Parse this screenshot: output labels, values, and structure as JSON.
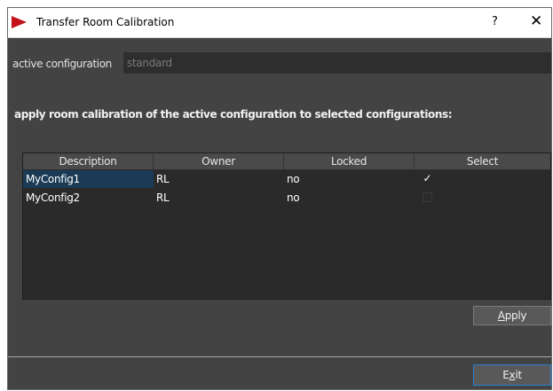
{
  "window": {
    "title": "Transfer Room Calibration",
    "help_label": "?",
    "close_label": "✕"
  },
  "active_configuration": {
    "label": "active configuration",
    "value": "standard"
  },
  "instruction": "apply room calibration of the active configuration to selected configurations:",
  "table": {
    "columns": [
      "Description",
      "Owner",
      "Locked",
      "Select"
    ],
    "rows": [
      {
        "description": "MyConfig1",
        "owner": "RL",
        "locked": "no",
        "select": true,
        "select_glyph": "✓"
      },
      {
        "description": "MyConfig2",
        "owner": "RL",
        "locked": "no",
        "select": false,
        "select_glyph": ""
      }
    ]
  },
  "buttons": {
    "apply_first": "A",
    "apply_rest": "pply",
    "exit_first": "E",
    "exit_mid": "x",
    "exit_rest": "it"
  },
  "colors": {
    "accent": "#2d7fd0",
    "brand": "#c4121a",
    "panel": "#434343",
    "selection": "#1a3a55"
  }
}
